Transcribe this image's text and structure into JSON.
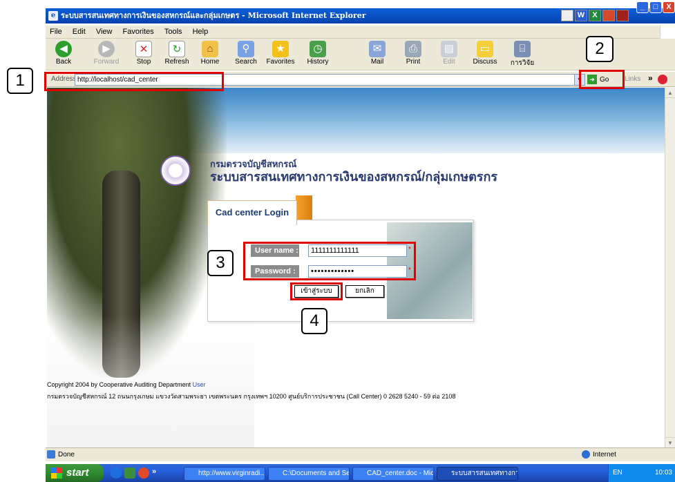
{
  "window": {
    "title": "ระบบสารสนเทศทางการเงินของสหกรณ์และกลุ่มเกษตร - Microsoft Internet Explorer",
    "min": "_",
    "max": "□",
    "close": "X"
  },
  "menu": [
    "File",
    "Edit",
    "View",
    "Favorites",
    "Tools",
    "Help"
  ],
  "toolbar": {
    "back": "Back",
    "forward": "Forward",
    "stop": "Stop",
    "refresh": "Refresh",
    "home": "Home",
    "search": "Search",
    "favorites": "Favorites",
    "history": "History",
    "mail": "Mail",
    "print": "Print",
    "edit": "Edit",
    "discuss": "Discuss",
    "research": "การวิจัย"
  },
  "address": {
    "label": "Address",
    "value": "http://localhost/cad_center",
    "go": "Go",
    "links": "Links"
  },
  "page": {
    "org_name": "กรมตรวจบัญชีสหกรณ์",
    "system_name": "ระบบสารสนเทศทางการเงินของสหกรณ์/กลุ่มเกษตรกร",
    "login_title": "Cad center Login",
    "username_label": "User name :",
    "username_value": "1111111111111",
    "password_label": "Password :",
    "password_value": "•••••••••••••",
    "required_mark": "*",
    "login_button": "เข้าสู่ระบบ",
    "cancel_button": "ยกเลิก",
    "copyright": "Copyright 2004 by Cooperative Auditing Department",
    "copyright_link": "User",
    "address_line": "กรมตรวจบัญชีสหกรณ์ 12 ถนนกรุงเกษม แขวงวัดสามพระยา เขตพระนคร กรุงเทพฯ 10200 ศูนย์บริการประชาชน (Call Center) 0 2628 5240 - 59 ต่อ 2108"
  },
  "status": {
    "left": "Done",
    "zone": "Internet"
  },
  "taskbar": {
    "start": "start",
    "tasks": [
      "http://www.virginradi...",
      "C:\\Documents and Se...",
      "CAD_center.doc - Mic...",
      "ระบบสารสนเทศทางกา..."
    ],
    "lang": "EN",
    "clock": "10:03"
  },
  "callouts": {
    "n1": "1",
    "n2": "2",
    "n3": "3",
    "n4": "4"
  },
  "colors": {
    "callout": "#e00000",
    "xp_blue": "#0a5fd8",
    "login_title": "#1e3c6f",
    "tab_orange": "#f7a22a"
  }
}
